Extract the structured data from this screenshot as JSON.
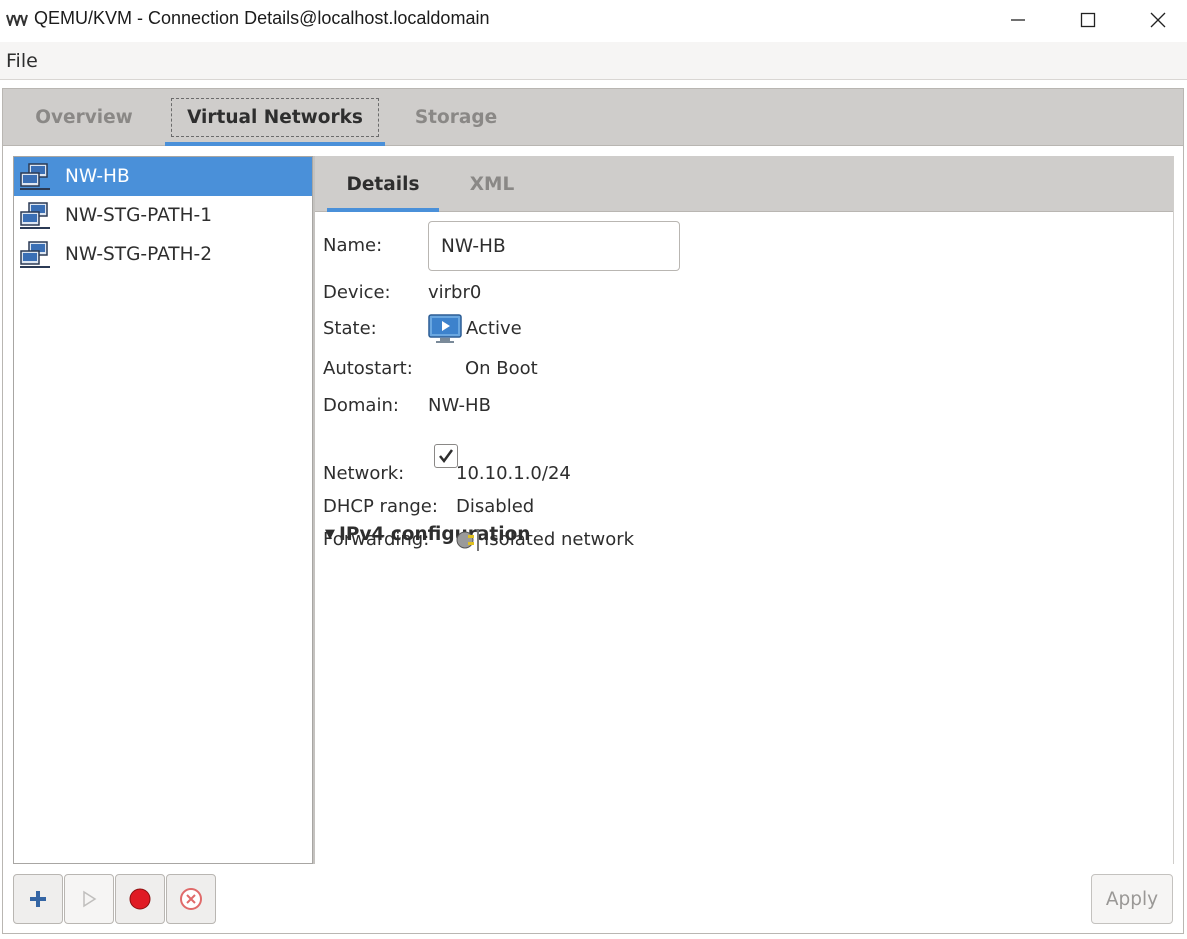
{
  "window": {
    "title": "QEMU/KVM - Connection Details@localhost.localdomain",
    "app_icon": "vmm-logo-icon",
    "controls": [
      "minimize-icon",
      "maximize-icon",
      "close-icon"
    ]
  },
  "menubar": {
    "items": [
      {
        "label": "File"
      }
    ]
  },
  "main_tabs": [
    {
      "label": "Overview",
      "active": false
    },
    {
      "label": "Virtual Networks",
      "active": true
    },
    {
      "label": "Storage",
      "active": false
    }
  ],
  "networks": [
    {
      "name": "NW-HB",
      "selected": true,
      "icon": "network-icon"
    },
    {
      "name": "NW-STG-PATH-1",
      "selected": false,
      "icon": "network-icon"
    },
    {
      "name": "NW-STG-PATH-2",
      "selected": false,
      "icon": "network-icon"
    }
  ],
  "detail_tabs": [
    {
      "label": "Details",
      "active": true
    },
    {
      "label": "XML",
      "active": false
    }
  ],
  "details": {
    "name_label": "Name:",
    "name_value": "NW-HB",
    "device_label": "Device:",
    "device_value": "virbr0",
    "state_label": "State:",
    "state_value": "Active",
    "state_icon": "running-monitor-icon",
    "autostart_label": "Autostart:",
    "autostart_value": "On Boot",
    "autostart_checked": true,
    "domain_label": "Domain:",
    "domain_value": "NW-HB",
    "ipv4": {
      "heading": "IPv4 configuration",
      "expanded": true,
      "network_label": "Network:",
      "network_value": "10.10.1.0/24",
      "dhcp_label": "DHCP range:",
      "dhcp_value": "Disabled",
      "forwarding_label": "Forwarding:",
      "forwarding_value": "Isolated network",
      "forwarding_icon": "isolated-plug-icon"
    }
  },
  "toolbar": {
    "buttons": [
      {
        "icon": "add-icon",
        "enabled": true
      },
      {
        "icon": "start-icon",
        "enabled": false
      },
      {
        "icon": "stop-icon",
        "enabled": true
      },
      {
        "icon": "delete-icon",
        "enabled": true
      }
    ],
    "apply_label": "Apply",
    "apply_enabled": false
  },
  "colors": {
    "accent": "#4a90d9",
    "tab_bar": "#cfcdcb",
    "stop_red": "#e01b24"
  }
}
